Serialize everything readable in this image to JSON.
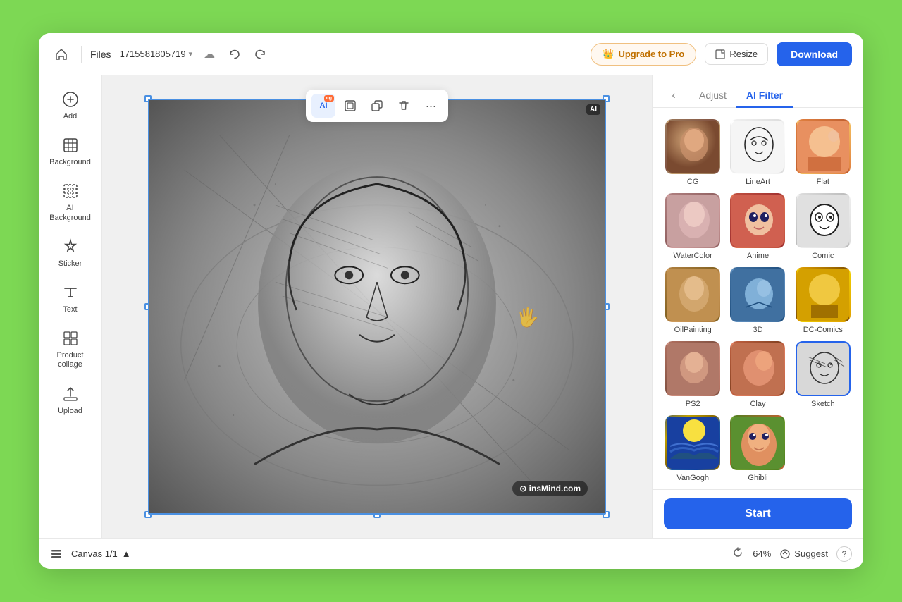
{
  "header": {
    "home_icon": "🏠",
    "files_label": "Files",
    "filename": "1715581805719",
    "chevron": "▾",
    "cloud_icon": "☁",
    "undo_icon": "↩",
    "redo_icon": "↪",
    "upgrade_label": "Upgrade to Pro",
    "upgrade_icon": "👑",
    "resize_label": "Resize",
    "resize_icon": "⊡",
    "download_label": "Download"
  },
  "sidebar": {
    "items": [
      {
        "id": "add",
        "icon": "⊕",
        "label": "Add"
      },
      {
        "id": "background",
        "icon": "▦",
        "label": "Background"
      },
      {
        "id": "ai-background",
        "icon": "▩",
        "label": "AI\nBackground"
      },
      {
        "id": "sticker",
        "icon": "🎀",
        "label": "Sticker"
      },
      {
        "id": "text",
        "icon": "T",
        "label": "Text"
      },
      {
        "id": "product-collage",
        "icon": "⊞",
        "label": "Product\ncollage"
      },
      {
        "id": "upload",
        "icon": "⬆",
        "label": "Upload"
      }
    ]
  },
  "canvas": {
    "ai_badge": "AI",
    "zoom": "64%",
    "canvas_info": "Canvas 1/1",
    "watermark": "⊙ insMind.com",
    "toolbar": {
      "ai_btn": "AI",
      "new_badge": "New",
      "frame_btn": "⊡",
      "copy_btn": "⧉",
      "delete_btn": "🗑",
      "more_btn": "···"
    }
  },
  "bottom_bar": {
    "layers_icon": "≡",
    "canvas_label": "Canvas 1/1",
    "chevron_up": "▲",
    "refresh_icon": "↻",
    "zoom_label": "64%",
    "suggest_icon": "⊙",
    "suggest_label": "Suggest",
    "help_label": "?"
  },
  "right_panel": {
    "back_icon": "‹",
    "adjust_tab": "Adjust",
    "ai_filter_tab": "AI Filter",
    "start_btn": "Start",
    "filters": [
      {
        "id": "cg",
        "label": "CG",
        "class": "ft-cg",
        "selected": false
      },
      {
        "id": "lineart",
        "label": "LineArt",
        "class": "ft-lineart",
        "selected": false
      },
      {
        "id": "flat",
        "label": "Flat",
        "class": "ft-flat",
        "selected": false
      },
      {
        "id": "watercolor",
        "label": "WaterColor",
        "class": "ft-watercolor",
        "selected": false
      },
      {
        "id": "anime",
        "label": "Anime",
        "class": "ft-anime",
        "selected": false
      },
      {
        "id": "comic",
        "label": "Comic",
        "class": "ft-comic",
        "selected": false
      },
      {
        "id": "oilpainting",
        "label": "OilPainting",
        "class": "ft-oilpainting",
        "selected": false
      },
      {
        "id": "3d",
        "label": "3D",
        "class": "ft-3d",
        "selected": false
      },
      {
        "id": "dccomics",
        "label": "DC-Comics",
        "class": "ft-dccomics",
        "selected": false
      },
      {
        "id": "ps2",
        "label": "PS2",
        "class": "ft-ps2",
        "selected": false
      },
      {
        "id": "clay",
        "label": "Clay",
        "class": "ft-clay",
        "selected": false
      },
      {
        "id": "sketch",
        "label": "Sketch",
        "class": "ft-sketch",
        "selected": true
      },
      {
        "id": "vangogh",
        "label": "VanGogh",
        "class": "ft-vangogh",
        "selected": false
      },
      {
        "id": "ghibli",
        "label": "Ghibli",
        "class": "ft-ghibli",
        "selected": false
      }
    ]
  }
}
